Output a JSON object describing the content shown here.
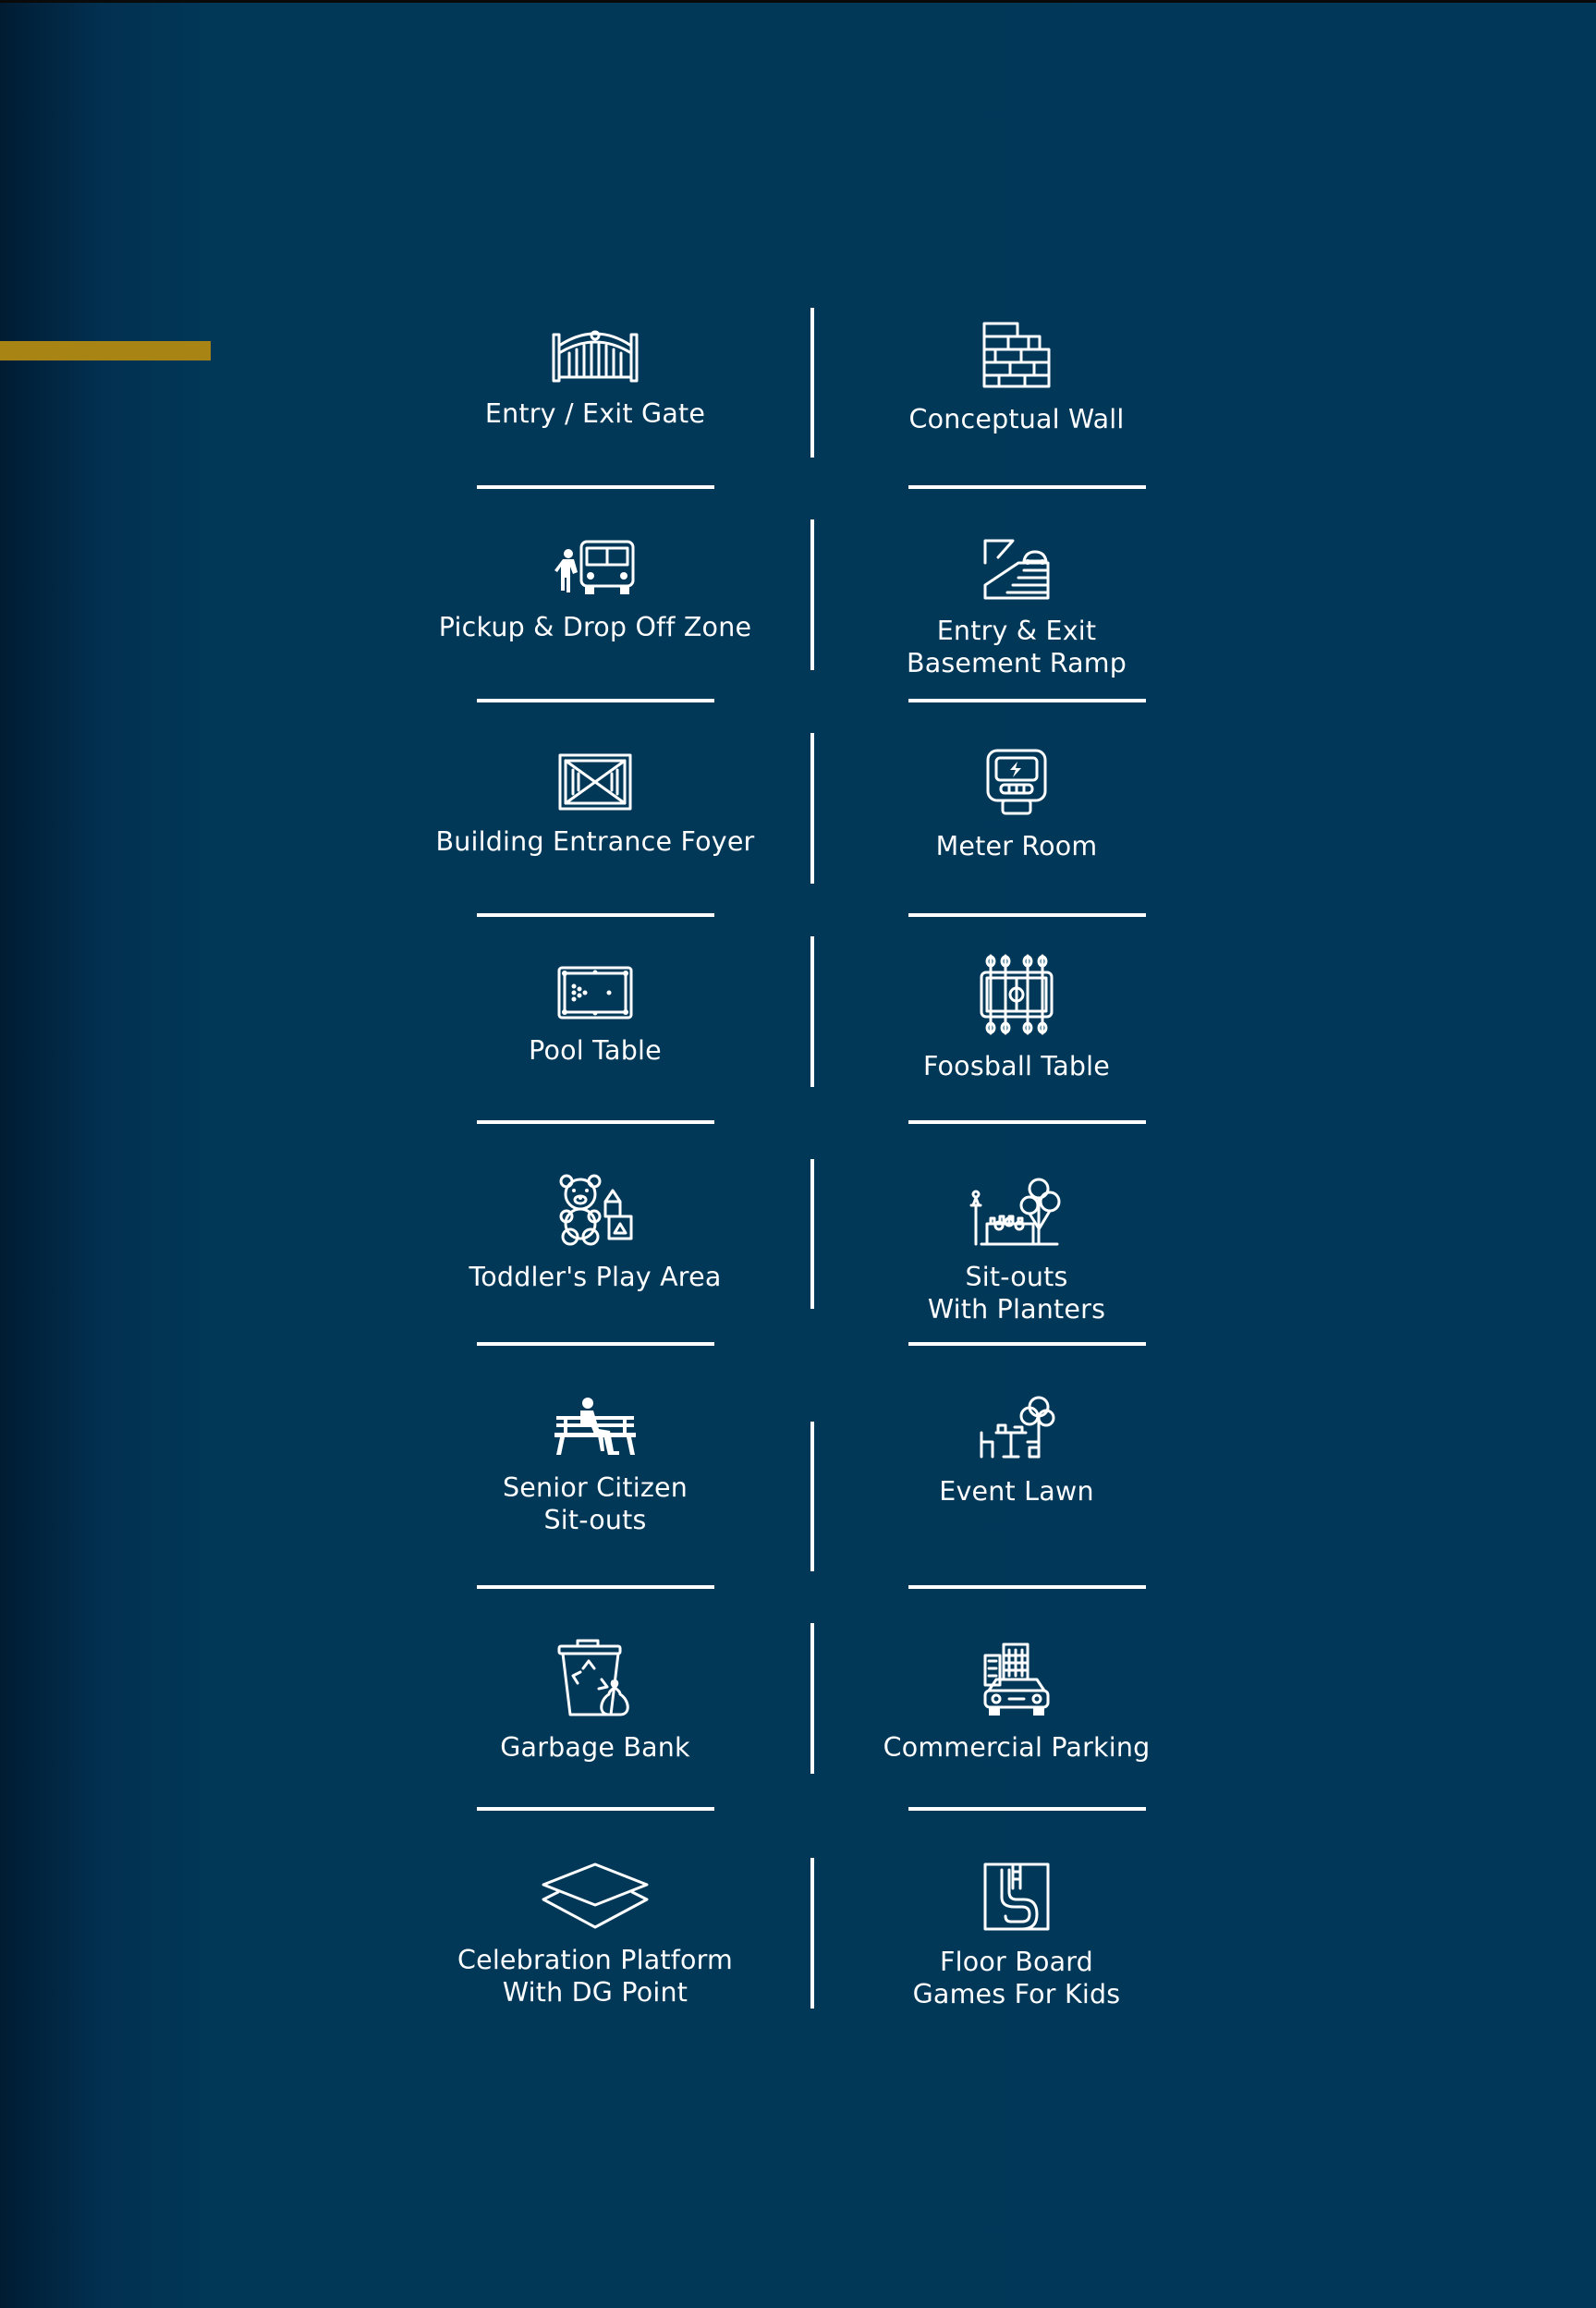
{
  "colors": {
    "background": "#013758",
    "accent": "#a88414",
    "text": "#ffffff"
  },
  "amenities": [
    {
      "label": "Entry / Exit Gate",
      "icon": "gate-icon"
    },
    {
      "label": "Conceptual Wall",
      "icon": "brick-wall-icon"
    },
    {
      "label": "Pickup & Drop Off Zone",
      "icon": "school-bus-icon"
    },
    {
      "label": "Entry & Exit\nBasement Ramp",
      "icon": "ramp-icon"
    },
    {
      "label": "Building Entrance Foyer",
      "icon": "foyer-icon"
    },
    {
      "label": "Meter Room",
      "icon": "electric-meter-icon"
    },
    {
      "label": "Pool Table",
      "icon": "pool-table-icon"
    },
    {
      "label": "Foosball Table",
      "icon": "foosball-table-icon"
    },
    {
      "label": "Toddler's Play Area",
      "icon": "teddy-bear-icon"
    },
    {
      "label": "Sit-outs\nWith Planters",
      "icon": "park-planters-icon"
    },
    {
      "label": "Senior Citizen\nSit-outs",
      "icon": "park-bench-icon"
    },
    {
      "label": "Event Lawn",
      "icon": "event-lawn-icon"
    },
    {
      "label": "Garbage Bank",
      "icon": "garbage-bin-icon"
    },
    {
      "label": "Commercial Parking",
      "icon": "parking-car-icon"
    },
    {
      "label": "Celebration Platform\nWith DG Point",
      "icon": "platform-layers-icon"
    },
    {
      "label": "Floor Board\nGames For Kids",
      "icon": "floor-game-icon"
    }
  ]
}
